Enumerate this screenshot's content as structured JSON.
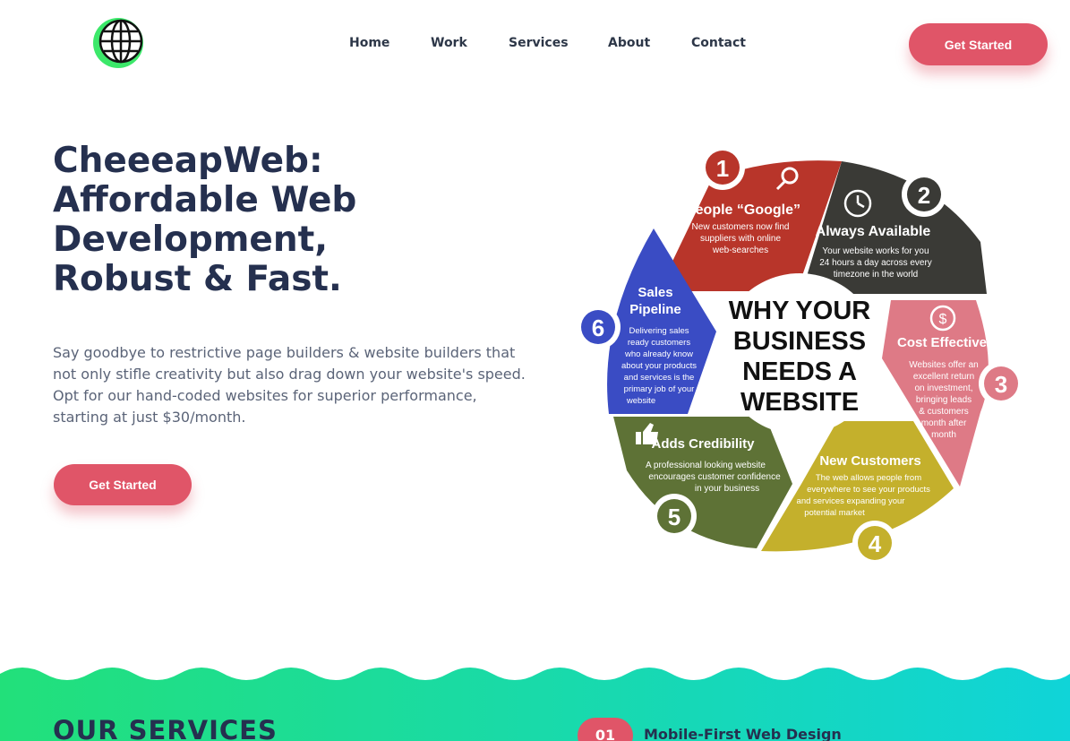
{
  "header": {
    "logo_icon": "globe-icon",
    "nav": [
      "Home",
      "Work",
      "Services",
      "About",
      "Contact"
    ],
    "cta_label": "Get Started"
  },
  "hero": {
    "title_lines": [
      "CheeeapWeb:",
      "Affordable Web",
      "Development,",
      "Robust & Fast."
    ],
    "description": "Say goodbye to restrictive page builders & website builders that not only stifle creativity but also drag down your website's speed. Opt for our hand-coded websites for superior performance, starting at just $30/month.",
    "cta_label": "Get Started"
  },
  "infographic": {
    "center": [
      "WHY YOUR",
      "BUSINESS",
      "NEEDS A",
      "WEBSITE"
    ],
    "segments": [
      {
        "num": "1",
        "title": "People “Google”",
        "lines": [
          "New customers now find",
          "suppliers with online",
          "web-searches"
        ],
        "color": "#b8352a"
      },
      {
        "num": "2",
        "title": "Always Available",
        "lines": [
          "Your website works for you",
          "24 hours a day across every",
          "timezone in the world"
        ],
        "color": "#3a3a36"
      },
      {
        "num": "3",
        "title": "Cost Effective",
        "lines": [
          "Websites offer an",
          "excellent return",
          "on investment,",
          "bringing leads",
          "& customers",
          "month after",
          "month"
        ],
        "color": "#de7a86"
      },
      {
        "num": "4",
        "title": "New Customers",
        "lines": [
          "The web allows people from",
          "everywhere to see your products",
          "and services expanding your",
          "potential market"
        ],
        "color": "#c4b02c"
      },
      {
        "num": "5",
        "title": "Adds Credibility",
        "lines": [
          "A professional looking website",
          "encourages customer confidence",
          "in your business"
        ],
        "color": "#5e7236"
      },
      {
        "num": "6",
        "title_lines": [
          "Sales",
          "Pipeline"
        ],
        "lines": [
          "Delivering sales",
          "ready customers",
          "who already know",
          "about your products",
          "and services is the",
          "primary job of your",
          "website"
        ],
        "color": "#3a4cc4"
      }
    ]
  },
  "services": {
    "title": "OUR SERVICES",
    "first_item": {
      "num": "01",
      "label": "Mobile-First Web Design"
    }
  },
  "colors": {
    "accent": "#e05568",
    "heading": "#25304f",
    "band_start": "#22e07a",
    "band_end": "#10d4d8"
  }
}
